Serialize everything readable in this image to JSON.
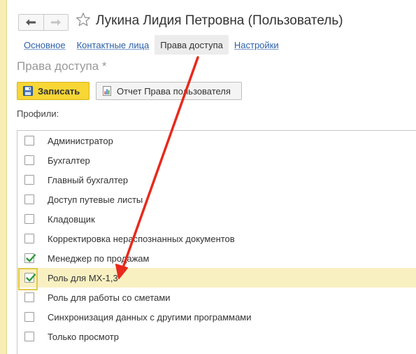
{
  "window": {
    "title": "Лукина Лидия Петровна (Пользователь)",
    "star_icon": "star-icon",
    "nav": {
      "back_icon": "arrow-left-icon",
      "forward_icon": "arrow-right-icon"
    }
  },
  "tabs": [
    {
      "label": "Основное",
      "active": false
    },
    {
      "label": "Контактные лица",
      "active": false
    },
    {
      "label": "Права доступа",
      "active": true
    },
    {
      "label": "Настройки",
      "active": false
    }
  ],
  "section": {
    "title": "Права доступа *"
  },
  "toolbar": {
    "save_label": "Записать",
    "save_icon": "floppy-disk-icon",
    "report_label": "Отчет Права пользователя",
    "report_icon": "report-icon"
  },
  "profiles": {
    "label": "Профили:",
    "items": [
      {
        "label": "Администратор",
        "checked": false,
        "selected": false
      },
      {
        "label": "Бухгалтер",
        "checked": false,
        "selected": false
      },
      {
        "label": "Главный бухгалтер",
        "checked": false,
        "selected": false
      },
      {
        "label": "Доступ путевые листы",
        "checked": false,
        "selected": false
      },
      {
        "label": "Кладовщик",
        "checked": false,
        "selected": false
      },
      {
        "label": "Корректировка нераспознанных документов",
        "checked": false,
        "selected": false
      },
      {
        "label": "Менеджер по продажам",
        "checked": true,
        "selected": false
      },
      {
        "label": "Роль для МХ-1,3",
        "checked": true,
        "selected": true
      },
      {
        "label": "Роль для работы со сметами",
        "checked": false,
        "selected": false
      },
      {
        "label": "Синхронизация данных с другими программами",
        "checked": false,
        "selected": false
      },
      {
        "label": "Только просмотр",
        "checked": false,
        "selected": false
      }
    ]
  },
  "colors": {
    "accent_yellow": "#f7d635",
    "link_blue": "#2b5fa7",
    "check_green": "#2e9b3c",
    "arrow_red": "#e8291c"
  }
}
